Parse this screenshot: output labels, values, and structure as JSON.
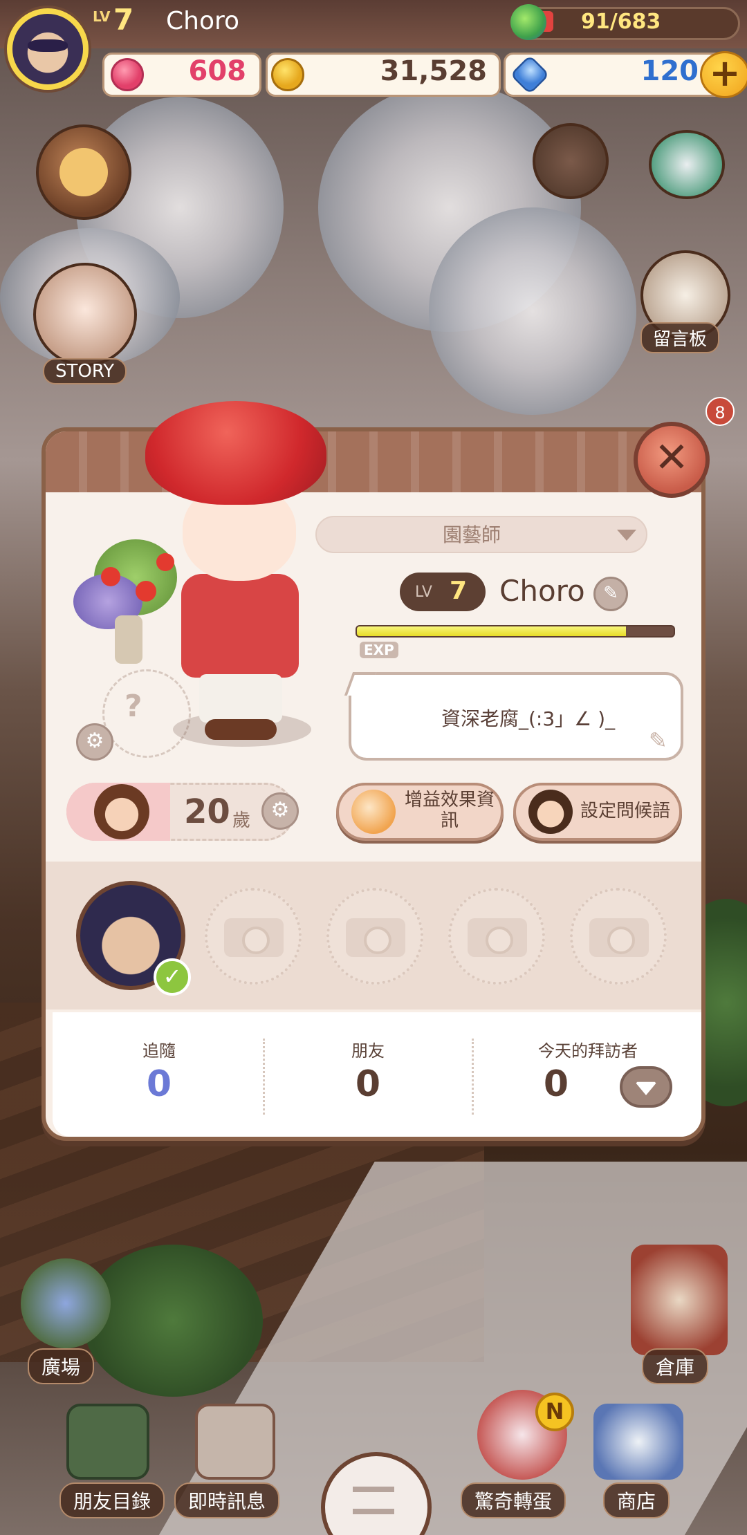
{
  "hud": {
    "lv_label": "LV",
    "level": "7",
    "player_name": "Choro",
    "energy": "91/683",
    "hearts": "608",
    "coins": "31,528",
    "gems": "120",
    "plus": "+"
  },
  "side": {
    "story": "STORY",
    "message_board": "留言板",
    "notification_count": "8"
  },
  "profile": {
    "close": "✕",
    "title_select": "園藝師",
    "lv_label": "LV",
    "level": "7",
    "name": "Choro",
    "exp_label": "EXP",
    "exp_progress": 0.85,
    "status_message": "資深老腐_(:3」∠ )_",
    "age_value": "20",
    "age_unit": "歲",
    "buff_info_button": "增益效果資訊",
    "greeting_button": "設定問候語",
    "plant_slot_placeholder": "?",
    "stats": {
      "follow_label": "追隨",
      "follow_value": "0",
      "friends_label": "朋友",
      "friends_value": "0",
      "visitors_label": "今天的拜訪者",
      "visitors_value": "0"
    }
  },
  "bottom_nav": {
    "plaza": "廣場",
    "warehouse": "倉庫",
    "friend_list": "朋友目錄",
    "instant_message": "即時訊息",
    "gacha": "驚奇轉蛋",
    "shop": "商店",
    "gacha_badge": "N"
  },
  "colors": {
    "hearts": "#e2406a",
    "coins": "#5a3e32",
    "gems": "#2f6fcf",
    "follow": "#6b79d6",
    "friends": "#5a3e32",
    "visitors": "#5a3e32",
    "accent": "#a4715b"
  }
}
